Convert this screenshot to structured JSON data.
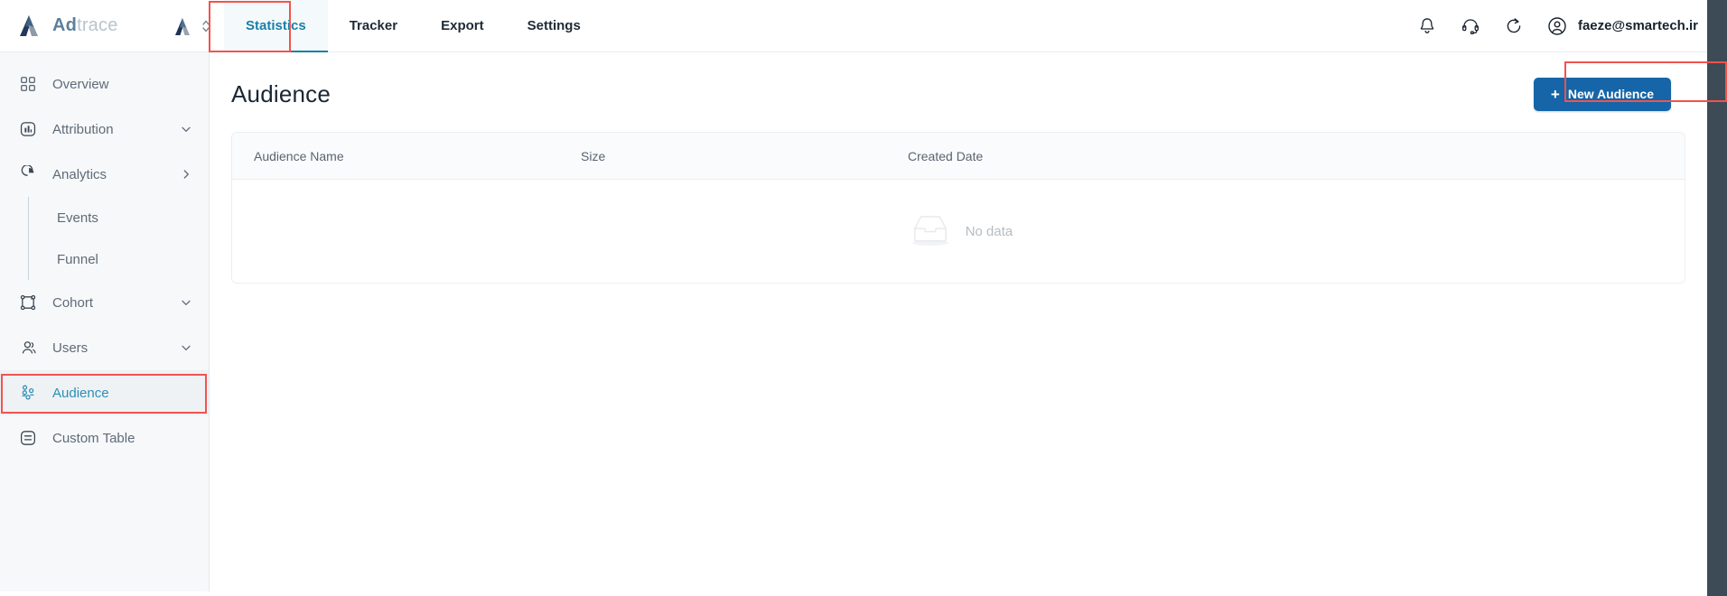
{
  "brand": {
    "logo_icon": "adtrace-logo-icon",
    "name_first": "Ad",
    "name_second": "trace"
  },
  "app_selector": {
    "icon": "app-avatar-icon",
    "caret_icon": "chevron-up-down-icon"
  },
  "topnav": {
    "tabs": [
      {
        "label": "Statistics",
        "active": true
      },
      {
        "label": "Tracker",
        "active": false
      },
      {
        "label": "Export",
        "active": false
      },
      {
        "label": "Settings",
        "active": false
      }
    ]
  },
  "topbar_right": {
    "notifications_icon": "bell-icon",
    "support_icon": "headset-icon",
    "refresh_icon": "refresh-icon",
    "avatar_icon": "user-circle-icon",
    "user_email": "faeze@smartech.ir"
  },
  "sidebar": {
    "items": [
      {
        "label": "Overview",
        "icon": "grid-icon",
        "caret": "none",
        "active": false
      },
      {
        "label": "Attribution",
        "icon": "bar-chart-icon",
        "caret": "down",
        "active": false
      },
      {
        "label": "Analytics",
        "icon": "pie-chart-icon",
        "caret": "right",
        "active": false
      },
      {
        "label": "Cohort",
        "icon": "cohort-icon",
        "caret": "down",
        "active": false
      },
      {
        "label": "Users",
        "icon": "users-icon",
        "caret": "down",
        "active": false
      },
      {
        "label": "Audience",
        "icon": "audience-icon",
        "caret": "none",
        "active": true
      },
      {
        "label": "Custom Table",
        "icon": "table-icon",
        "caret": "none",
        "active": false
      }
    ],
    "analytics_subitems": [
      {
        "label": "Events"
      },
      {
        "label": "Funnel"
      }
    ]
  },
  "main": {
    "page_title": "Audience",
    "new_audience_button": "New Audience",
    "new_audience_plus": "+",
    "table": {
      "columns": [
        "Audience Name",
        "Size",
        "Created Date"
      ],
      "rows": [],
      "empty_label": "No data",
      "empty_icon": "empty-tray-icon"
    }
  },
  "colors": {
    "accent_teal": "#1a7fa8",
    "primary_blue": "#1565a8",
    "annotation_red": "#f2534d",
    "sidebar_bg": "#f6f8fa",
    "scrollbar_band": "#3c4b55"
  }
}
